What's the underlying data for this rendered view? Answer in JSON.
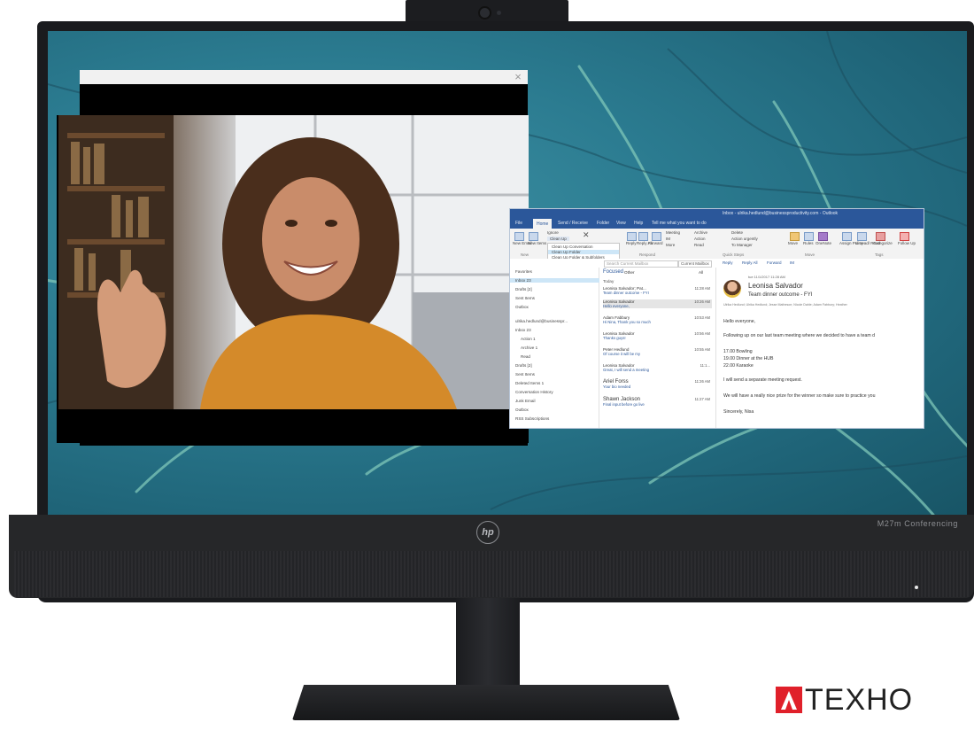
{
  "monitor": {
    "logo_text": "hp",
    "model_label": "M27m Conferencing"
  },
  "brand": {
    "text": "TEXHO",
    "mark_color": "#e0202a"
  },
  "call_window": {
    "close_icon": "close-icon"
  },
  "outlook": {
    "title": "Inbox - ulrika.hedlund@businessproductivity.com - Outlook",
    "tabs": [
      "File",
      "Home",
      "Send / Receive",
      "Folder",
      "View",
      "Help",
      "Tell me what you want to do"
    ],
    "ribbon": {
      "new_email": "New Email",
      "new_items": "New Items",
      "ignore": "Ignore",
      "clean_up": "Clean Up",
      "clean_up_menu": [
        "Clean Up Conversation",
        "Clean Up Folder",
        "Clean Up Folder & Subfolders"
      ],
      "reply": "Reply",
      "reply_all": "Reply All",
      "forward": "Forward",
      "meeting": "Meeting",
      "im": "IM",
      "more": "More",
      "archive": "Archive",
      "action": "Action",
      "read": "Read",
      "delete_item": "Delete",
      "action_urgently": "Action urgently",
      "to_manager": "To Manager",
      "move": "Move",
      "rules": "Rules",
      "onenote": "OneNote",
      "assign_policy": "Assign Policy",
      "unread_read": "Unread/ Read",
      "categorize": "Categorize",
      "follow_up": "Follow Up",
      "group_new": "New",
      "group_respond": "Respond",
      "group_quick_steps": "Quick Steps",
      "group_move": "Move",
      "group_tags": "Tags"
    },
    "search": {
      "placeholder": "Search Current Mailbox",
      "scope": "Current Mailbox"
    },
    "folders": [
      "Favorites",
      "Inbox 23",
      "Drafts [2]",
      "Sent Items",
      "Outbox",
      "ulrika.hedlund@businesspr...",
      "Inbox 23",
      "Action 1",
      "Archive 1",
      "Read",
      "Drafts [2]",
      "Sent Items",
      "Deleted Items 1",
      "Conversation History",
      "Junk Email",
      "Outbox",
      "RSS Subscriptions"
    ],
    "list_tabs": [
      "Focused",
      "Other"
    ],
    "list_filter": "All",
    "list_group": "Today",
    "messages": [
      {
        "from": "Leonisa Salvador; Pat...",
        "subject": "Team dinner outcome - FYI",
        "time": "11:28 AM"
      },
      {
        "from": "Leonisa Salvador",
        "subject": "Hello everyone,",
        "time": "10:26 AM"
      },
      {
        "from": "Adam Fabbury",
        "subject": "Hi Nina,  Thank you so much",
        "time": "10:53 AM"
      },
      {
        "from": "Leonisa Salvador",
        "subject": "Thanks guys!",
        "time": "10:56 AM"
      },
      {
        "from": "Peter Hedlund",
        "subject": "Of course it will be my",
        "time": "10:55 AM"
      },
      {
        "from": "Leonisa Salvador",
        "subject": "Great, I will send a meeting",
        "time": "11:1..."
      },
      {
        "from": "Ariel Forss",
        "subject": "Your bio needed",
        "time": "11:26 AM"
      },
      {
        "from": "Shawn Jackson",
        "subject": "Final input before go live",
        "time": "11:27 AM"
      }
    ],
    "reading": {
      "actions": [
        "Reply",
        "Reply All",
        "Forward",
        "IM"
      ],
      "date": "tue 11/1/2017 11:28 AM",
      "sender": "Leonisa Salvador",
      "subject": "Team dinner outcome - FYI",
      "recipients": "Ulrika Hedlund; Ulrika Hedlund; Jesse Matheson; Nicole Dahle; Adam Fabbury; Heather",
      "body": [
        "Hello everyone,",
        "Following up on our last team meeting where we decided to have a team d",
        "17.00 Bowling",
        "19.00 Dinner at the HUB",
        "22.00 Karaoke",
        "I will send a separate meeting request.",
        "We will have a really nice prize for the winner so make sure to practice you",
        "Sincerely, Nisa"
      ]
    }
  }
}
